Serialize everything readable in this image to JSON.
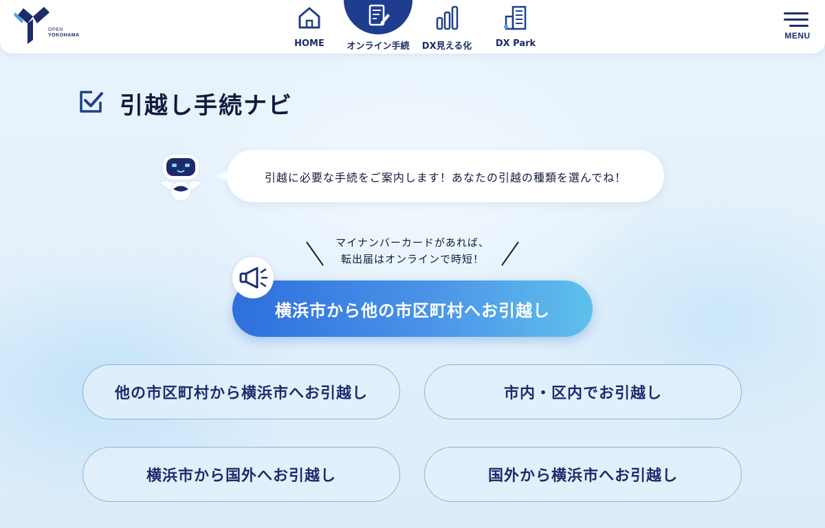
{
  "header": {
    "logo": {
      "small": "OPEN",
      "big": "YOKOHAMA"
    },
    "nav": [
      {
        "label": "HOME",
        "icon": "home-icon",
        "active": false
      },
      {
        "label": "オンライン手続",
        "icon": "document-pen-icon",
        "active": true
      },
      {
        "label": "DX見える化",
        "icon": "bar-chart-icon",
        "active": false
      },
      {
        "label": "DX Park",
        "icon": "buildings-icon",
        "active": false
      }
    ],
    "menu_label": "MENU"
  },
  "page": {
    "title": "引越し手続ナビ",
    "bubble_text": "引越に必要な手続をご案内します！あなたの引越の種類を選んでね！",
    "hint_line1": "マイナンバーカードがあれば、",
    "hint_line2": "転出届はオンラインで時短！",
    "primary_button": "横浜市から他の市区町村へお引越し",
    "options": [
      "他の市区町村から横浜市へお引越し",
      "市内・区内でお引越し",
      "横浜市から国外へお引越し",
      "国外から横浜市へお引越し"
    ]
  },
  "colors": {
    "navy": "#1d2b6b",
    "active_nav": "#1f3d8f",
    "primary_gradient_start": "#2e6fdd",
    "primary_gradient_end": "#5fc0ec",
    "background": "#e4f1fb"
  }
}
